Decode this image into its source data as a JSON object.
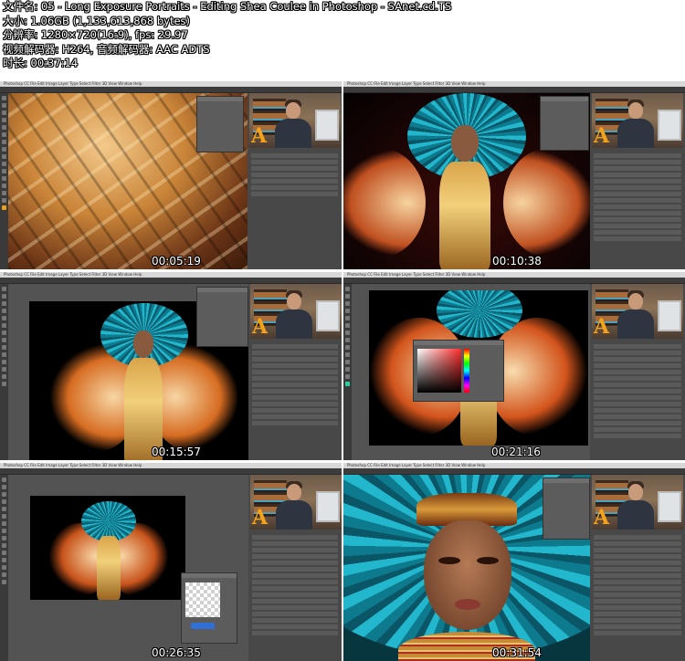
{
  "header": {
    "filename_line": "文件名: 05 - Long Exposure Portraits - Editing Shea Coulee in Photoshop - SAnet.cd.TS",
    "size_line": "大小: 1.06GB (1,133,613,868 bytes)",
    "resolution_line": "分辨率: 1280×720(16:9), fps: 29.97",
    "codec_line": "视频解码器: H264, 音频解码器: AAC ADTS",
    "duration_line": "时长: 00:37:14"
  },
  "app": {
    "menu_text": "Photoshop CC   File   Edit   Image   Layer   Type   Select   Filter   3D   View   Window   Help"
  },
  "thumbnails": [
    {
      "timestamp": "00:05:19"
    },
    {
      "timestamp": "00:10:38"
    },
    {
      "timestamp": "00:15:57"
    },
    {
      "timestamp": "00:21:16"
    },
    {
      "timestamp": "00:26:35"
    },
    {
      "timestamp": "00:31:54"
    }
  ],
  "colors": {
    "ps_background": "#535353",
    "ps_panel": "#484848",
    "feather_teal": "#22b7cc",
    "gold": "#e8b25a"
  }
}
